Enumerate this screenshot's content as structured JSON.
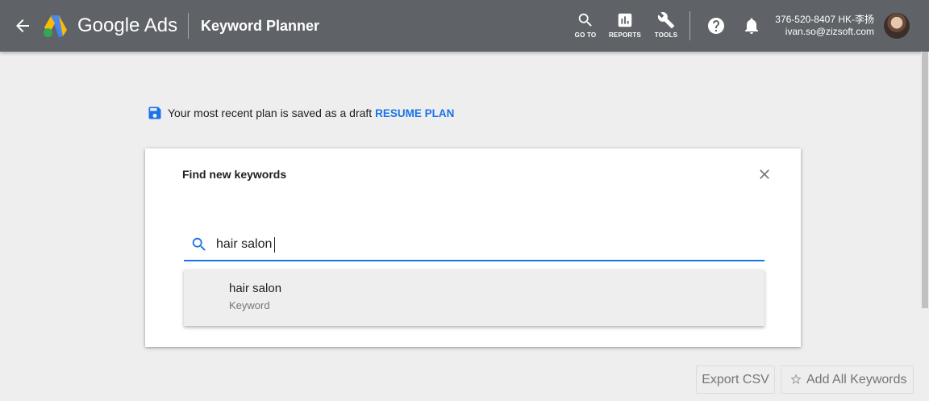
{
  "header": {
    "brand": "Google Ads",
    "page_title": "Keyword Planner",
    "nav": [
      {
        "label": "GO TO",
        "icon": "search-icon"
      },
      {
        "label": "REPORTS",
        "icon": "reports-icon"
      },
      {
        "label": "TOOLS",
        "icon": "wrench-icon"
      }
    ],
    "account_id": "376-520-8407 HK-李扬",
    "account_email": "ivan.so@zizsoft.com"
  },
  "draft_notice": {
    "text": "Your most recent plan is saved as a draft",
    "action": "RESUME PLAN"
  },
  "dialog": {
    "title": "Find new keywords",
    "search_value": "hair salon",
    "suggestions": [
      {
        "text": "hair salon",
        "type": "Keyword"
      }
    ]
  },
  "actions": {
    "export": "Export CSV",
    "add_all": "Add All Keywords"
  },
  "colors": {
    "topbar": "#5f6368",
    "accent": "#1a73e8",
    "background": "#eeeeee"
  }
}
